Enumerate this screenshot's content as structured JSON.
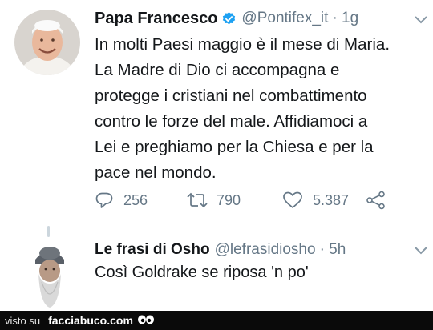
{
  "tweets": [
    {
      "author": "Papa Francesco",
      "handle": "@Pontifex_it",
      "time": "· 1g",
      "text": "In molti Paesi maggio è il mese di Maria. La Madre di Dio ci accompagna e protegge i cristiani nel combattimento contro le forze del male. Affidiamoci a Lei e preghiamo per la Chiesa e per la pace nel mondo.",
      "lines": [
        "In molti Paesi maggio è il mese di Maria.",
        "La Madre di Dio ci accompagna e",
        "protegge i cristiani nel combattimento",
        "contro le forze del male. Affidiamoci a",
        "Lei e preghiamo per la Chiesa e per la",
        "pace nel mondo."
      ],
      "replies": "256",
      "retweets": "790",
      "likes": "5.387",
      "verified": true
    },
    {
      "author": "Le frasi di Osho",
      "handle": "@lefrasidiosho",
      "time": "· 5h",
      "text": "Così Goldrake se riposa 'n po'",
      "verified": false
    }
  ],
  "footer": {
    "prefix": "visto su",
    "site": "facciabuco.com"
  },
  "icons": {
    "verified": "verified-badge-icon",
    "chevron": "chevron-down-icon",
    "reply": "reply-icon",
    "retweet": "retweet-icon",
    "like": "heart-icon",
    "share": "share-icon"
  },
  "colors": {
    "text": "#14171a",
    "secondary": "#657786",
    "verified": "#1da1f2",
    "footer_bg": "#0a0a0a"
  }
}
